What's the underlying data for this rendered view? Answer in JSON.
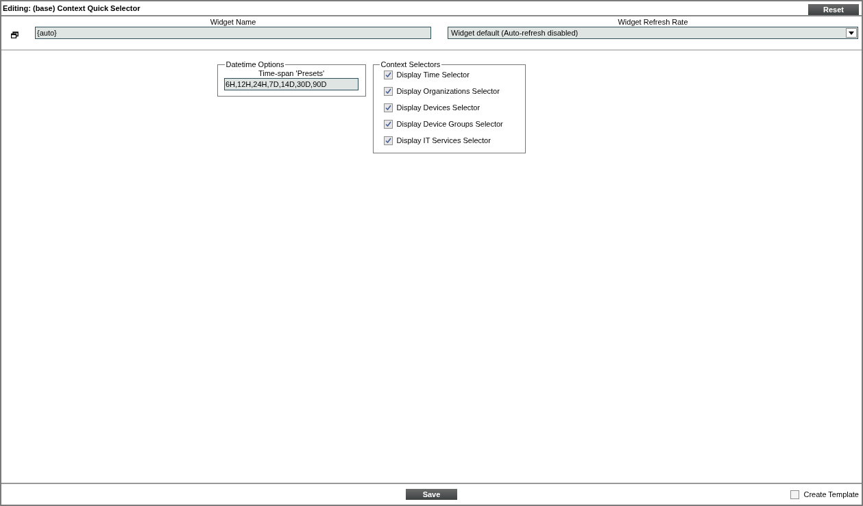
{
  "title": "Editing: (base) Context Quick Selector",
  "reset_button": "Reset",
  "widget_name": {
    "label": "Widget Name",
    "value": "{auto}"
  },
  "refresh_rate": {
    "label": "Widget Refresh Rate",
    "value": "Widget default (Auto-refresh disabled)"
  },
  "datetime_options": {
    "legend": "Datetime Options",
    "label": "Time-span 'Presets'",
    "value": "6H,12H,24H,7D,14D,30D,90D"
  },
  "context_selectors": {
    "legend": "Context Selectors",
    "items": [
      {
        "label": "Display Time Selector",
        "checked": true
      },
      {
        "label": "Display Organizations Selector",
        "checked": true
      },
      {
        "label": "Display Devices Selector",
        "checked": true
      },
      {
        "label": "Display Device Groups Selector",
        "checked": true
      },
      {
        "label": "Display IT Services Selector",
        "checked": true
      }
    ]
  },
  "save_button": "Save",
  "create_template": {
    "label": "Create Template",
    "checked": false
  }
}
